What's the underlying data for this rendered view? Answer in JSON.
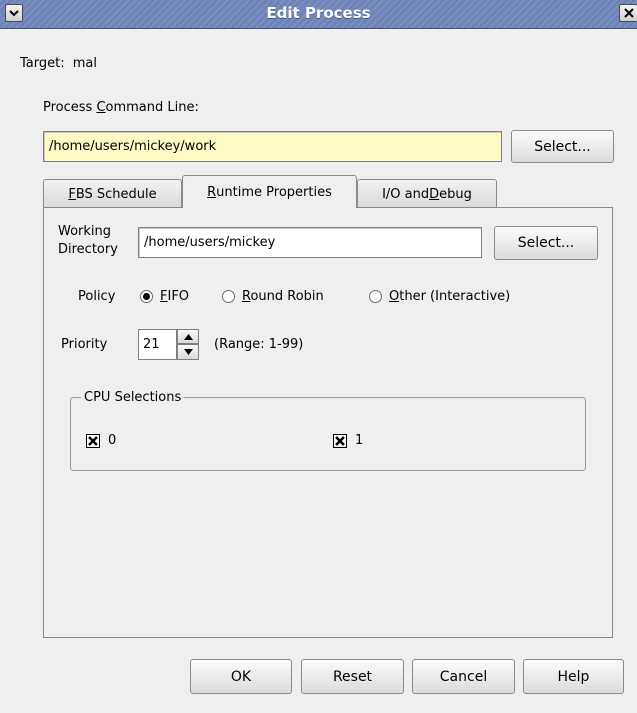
{
  "window": {
    "title": "Edit Process",
    "colors": {
      "titlebar": "#6c82b8",
      "highlight_field": "#fff9c4",
      "background": "#efefef"
    }
  },
  "target": {
    "label": "Target:",
    "value": "mal"
  },
  "command": {
    "label_pre": "Process ",
    "label_mnemonic": "C",
    "label_post": "ommand Line:",
    "value": "/home/users/mickey/work",
    "select_label": "Select..."
  },
  "tabs": [
    {
      "mnemonic": "F",
      "rest": "BS Schedule",
      "pre": ""
    },
    {
      "mnemonic": "R",
      "rest": "untime Properties",
      "pre": ""
    },
    {
      "pre": "I/O and ",
      "mnemonic": "D",
      "rest": "ebug"
    }
  ],
  "active_tab": "Runtime Properties",
  "runtime": {
    "workdir_label_line1": "Working",
    "workdir_label_line2": "Directory",
    "workdir_value": "/home/users/mickey",
    "workdir_select_label": "Select...",
    "policy_label": "Policy",
    "policy_options": [
      {
        "mnemonic": "F",
        "rest": "IFO",
        "selected": true
      },
      {
        "mnemonic": "R",
        "rest": "ound Robin",
        "selected": false
      },
      {
        "mnemonic": "O",
        "rest": "ther (Interactive)",
        "selected": false
      }
    ],
    "priority_label": "Priority",
    "priority_value": "21",
    "priority_range": "(Range: 1-99)",
    "cpu_group_label": "CPU Selections",
    "cpus": [
      {
        "label": "0",
        "checked": true
      },
      {
        "label": "1",
        "checked": true
      }
    ]
  },
  "buttons": {
    "ok": "OK",
    "reset": "Reset",
    "cancel": "Cancel",
    "help": "Help"
  },
  "icons": {
    "window_menu": "chevron-down-icon",
    "close": "close-icon",
    "spin_up": "arrow-up-icon",
    "spin_down": "arrow-down-icon",
    "check": "x-mark-icon"
  }
}
